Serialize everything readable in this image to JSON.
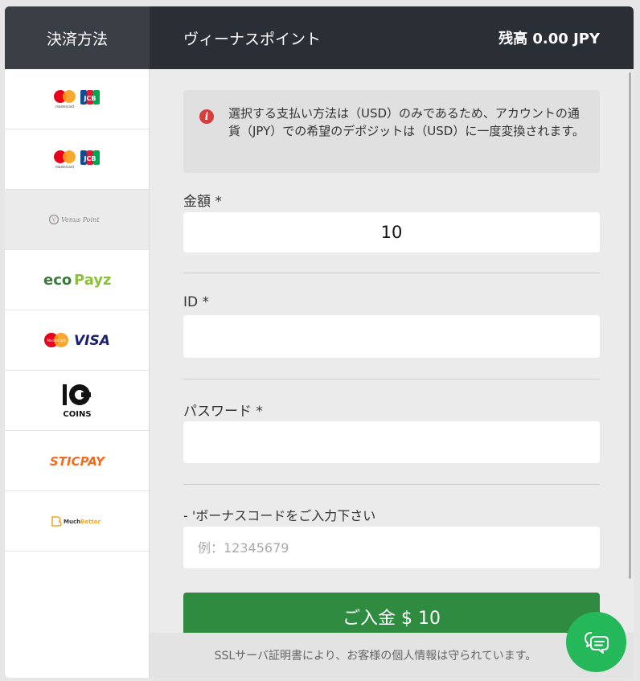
{
  "header": {
    "section_title": "決済方法",
    "method_title": "ヴィーナスポイント",
    "balance": "残高 0.00 JPY"
  },
  "sidebar": {
    "methods": [
      {
        "name": "mastercard-jcb",
        "mastercard_text": "mastercard",
        "jcb_text": "JCB",
        "active": false
      },
      {
        "name": "mastercard-jcb",
        "mastercard_text": "mastercard",
        "jcb_text": "JCB",
        "active": false
      },
      {
        "name": "venus-point",
        "text": "Venus Point",
        "active": true
      },
      {
        "name": "ecopayz",
        "text_eco": "eco",
        "text_payz": "Payz",
        "active": false
      },
      {
        "name": "mastercard-visa",
        "mastercard_text": "MasterCard",
        "visa_text": "VISA",
        "active": false
      },
      {
        "name": "10coins",
        "coins_text": "COINS",
        "active": false
      },
      {
        "name": "sticpay",
        "text": "STICPAY",
        "active": false
      },
      {
        "name": "muchbetter",
        "text_much": "Much",
        "text_better": "Better",
        "active": false
      }
    ]
  },
  "notice": {
    "text": "選択する支払い方法は（USD）のみであるため、アカウントの通貨（JPY）での希望のデポジットは（USD）に一度変換されます。"
  },
  "form": {
    "amount_label": "金額 *",
    "amount_value": "10",
    "id_label": "ID *",
    "id_value": "",
    "password_label": "パスワード *",
    "password_value": "",
    "bonus_label": "- 'ボーナスコードをご入力下さい",
    "bonus_placeholder": "例：12345679",
    "deposit_label": "ご入金 $ 10"
  },
  "footer": {
    "text": "SSLサーバ証明書により、お客様の個人情報は守られています。"
  },
  "colors": {
    "header_bg": "#2a2e35",
    "deposit_button": "#2e8b3f",
    "chat_button": "#25b85a",
    "notice_icon": "#d63d3d"
  },
  "icons": [
    "info-icon",
    "chat-icon"
  ]
}
